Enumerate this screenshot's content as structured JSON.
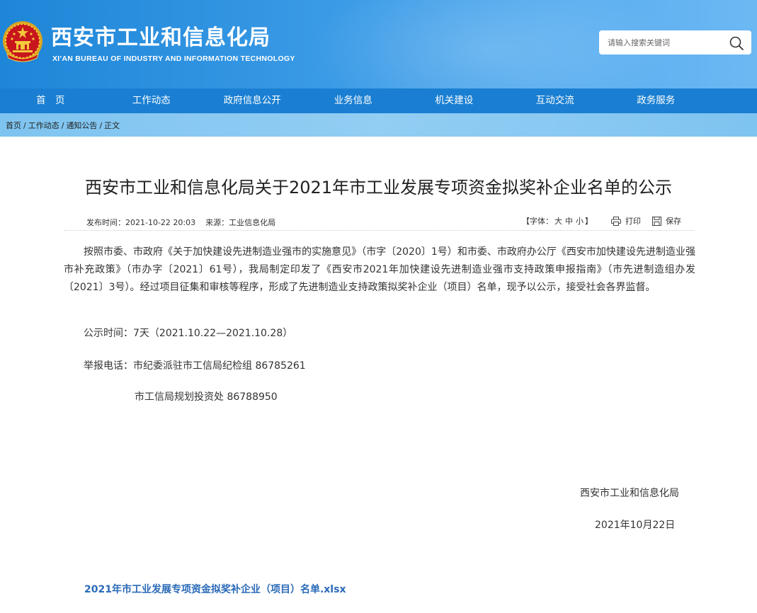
{
  "header": {
    "site_title": "西安市工业和信息化局",
    "site_subtitle": "XI'AN BUREAU OF INDUSTRY AND INFORMATION TECHNOLOGY",
    "search_placeholder": "请输入搜索关键词"
  },
  "nav": {
    "items": [
      "首　页",
      "工作动态",
      "政府信息公开",
      "业务信息",
      "机关建设",
      "互动交流",
      "政务服务"
    ]
  },
  "breadcrumb": {
    "items": [
      "首页",
      "工作动态",
      "通知公告",
      "正文"
    ],
    "separator": "/"
  },
  "article": {
    "title": "西安市工业和信息化局关于2021年市工业发展专项资金拟奖补企业名单的公示",
    "publish_time": "发布时间：2021-10-22 20:03",
    "source": "来源：工业信息化局",
    "font_label_open": "【字体：",
    "font_large": "大",
    "font_medium": "中",
    "font_small": "小",
    "font_label_close": "】",
    "print_label": "打印",
    "save_label": "保存",
    "paragraph1": "按照市委、市政府《关于加快建设先进制造业强市的实施意见》（市字〔2020〕1号）和市委、市政府办公厅《西安市加快建设先进制造业强市补充政策》（市办字〔2021〕61号），我局制定印发了《西安市2021年加快建设先进制造业强市支持政策申报指南》（市先进制造组办发〔2021〕3号）。经过项目征集和审核等程序，形成了先进制造业支持政策拟奖补企业（项目）名单，现予以公示，接受社会各界监督。",
    "notice_period": "公示时间：7天（2021.10.22—2021.10.28）",
    "report_phone_1": "举报电话：市纪委派驻市工信局纪检组 86785261",
    "report_phone_2": "市工信局规划投资处 86788950",
    "signoff_org": "西安市工业和信息化局",
    "signoff_date": "2021年10月22日",
    "attachment": "2021年市工业发展专项资金拟奖补企业（项目）名单.xlsx"
  },
  "colors": {
    "header_blue": "#1e86d8",
    "nav_blue": "#1a7fd2",
    "breadcrumb_blue": "#86c8f1",
    "link_blue": "#2a6ab8"
  },
  "icons": [
    "national-emblem-icon",
    "search-icon",
    "print-icon",
    "save-icon"
  ]
}
